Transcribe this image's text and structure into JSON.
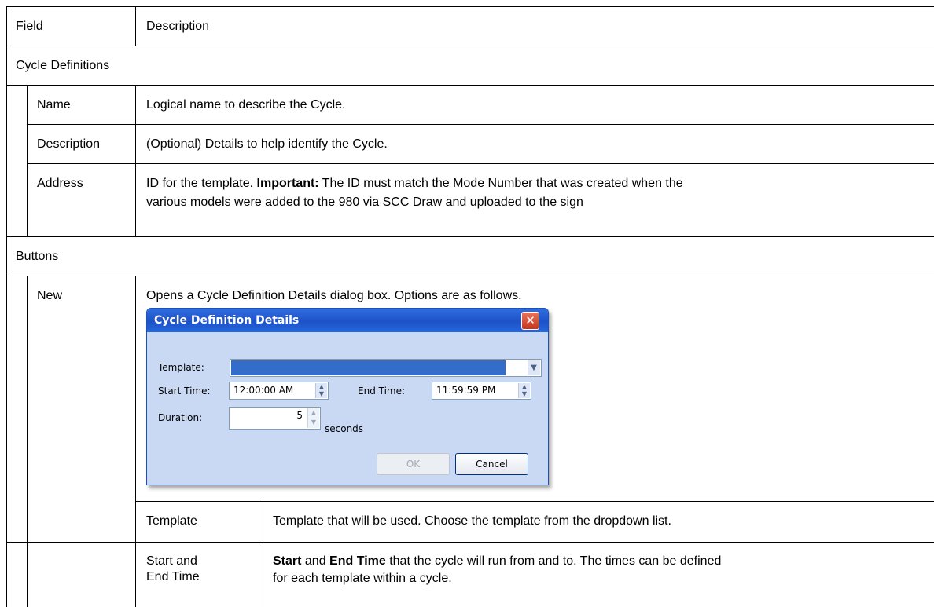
{
  "table": {
    "header": {
      "field": "Field",
      "description": "Description"
    },
    "section_cycle": "Cycle Definitions",
    "rows_cycle": [
      {
        "field": "Name",
        "description": "Logical name to describe the Cycle."
      },
      {
        "field": "Description",
        "description": "(Optional) Details to help identify the Cycle."
      },
      {
        "field": "Address",
        "description_pre": "ID for the template. ",
        "description_bold": "Important:",
        "description_line1_post": " The ID must match the Mode Number that was created when the",
        "description_line2": "various models were added to the 980 via SCC Draw and uploaded to the sign"
      }
    ],
    "section_buttons": "Buttons",
    "new_row": {
      "field": "New",
      "description": "Opens a Cycle Definition Details dialog box. Options are as follows."
    },
    "sub_rows": [
      {
        "field": "Template",
        "description": "Template that will be used. Choose the template from the dropdown list."
      },
      {
        "field_line1": "Start and",
        "field_line2": "End Time",
        "bold1": "Start",
        "mid1": " and ",
        "bold2": "End Time",
        "line1_post": " that the cycle will run from and to. The times can be defined",
        "line2": "for each template within a cycle."
      }
    ]
  },
  "dialog": {
    "title": "Cycle Definition Details",
    "close_glyph": "✕",
    "template_label": "Template:",
    "start_label": "Start Time:",
    "start_value": "12:00:00 AM",
    "end_label": "End Time:",
    "end_value": "11:59:59 PM",
    "duration_label": "Duration:",
    "duration_value": "5",
    "seconds_label": "seconds",
    "ok_label": "OK",
    "cancel_label": "Cancel",
    "icons": [
      "close-icon",
      "dropdown-arrow-icon",
      "spinner-icon"
    ]
  }
}
